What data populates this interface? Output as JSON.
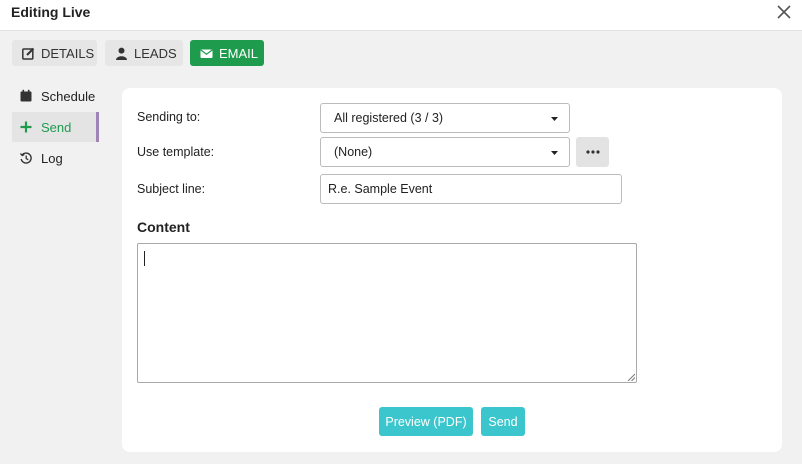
{
  "header": {
    "title": "Editing Live"
  },
  "tabs": [
    {
      "label": "DETAILS",
      "icon": "edit-icon"
    },
    {
      "label": "LEADS",
      "icon": "user-icon"
    },
    {
      "label": "EMAIL",
      "icon": "envelope-icon",
      "active": true
    }
  ],
  "side_nav": [
    {
      "label": "Schedule",
      "icon": "calendar-icon"
    },
    {
      "label": "Send",
      "icon": "plus-icon",
      "active": true
    },
    {
      "label": "Log",
      "icon": "history-icon"
    }
  ],
  "form": {
    "sending_to_label": "Sending to:",
    "sending_to_value": "All registered (3 / 3)",
    "template_label": "Use template:",
    "template_value": "(None)",
    "subject_label": "Subject line:",
    "subject_value": "R.e. Sample Event",
    "content_heading": "Content",
    "content_value": ""
  },
  "buttons": {
    "preview": "Preview (PDF)",
    "send": "Send"
  },
  "colors": {
    "accent_green": "#1f9b4e",
    "button_teal": "#3ac6cc",
    "active_indicator": "#a084b5"
  }
}
